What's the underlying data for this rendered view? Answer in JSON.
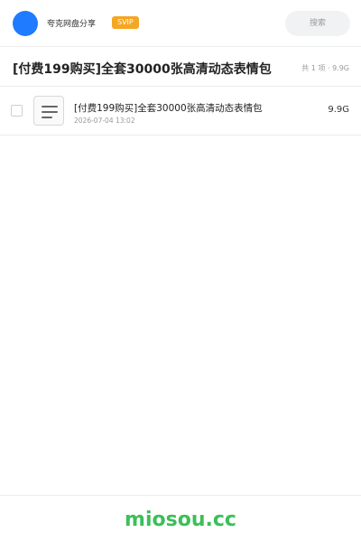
{
  "header": {
    "username": "夸克网盘分享",
    "badge": "SVIP",
    "search_placeholder": "搜索"
  },
  "share": {
    "title": "[付费199购买]全套30000张高清动态表情包",
    "meta": "共 1 项 · 9.9G"
  },
  "files": [
    {
      "name": "[付费199购买]全套30000张高清动态表情包",
      "date": "2026-07-04 13:02",
      "size": "9.9G",
      "icon": "folder-list-icon"
    }
  ],
  "footer": {
    "site": "miosou.cc"
  },
  "colors": {
    "avatar": "#1f7bff",
    "svip": "#f5a623",
    "footer_link": "#3bbf5a"
  }
}
